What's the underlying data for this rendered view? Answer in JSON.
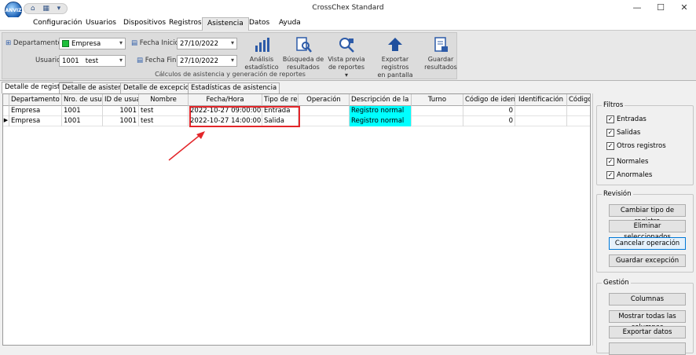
{
  "window": {
    "title": "CrossChex Standard",
    "logo_text": "ANVIZ"
  },
  "menu": [
    "Configuración",
    "Usuarios",
    "Dispositivos",
    "Registros",
    "Asistencia",
    "Datos",
    "Ayuda"
  ],
  "menu_active": "Asistencia",
  "ribbon": {
    "departamento_label": "Departamento",
    "departamento_value": "Empresa",
    "usuario_label": "Usuario",
    "usuario_id": "1001",
    "usuario_name": "test",
    "fecha_inicio_label": "Fecha Inicio",
    "fecha_inicio_value": "27/10/2022",
    "fecha_fin_label": "Fecha Fin",
    "fecha_fin_value": "27/10/2022",
    "buttons": [
      {
        "l1": "Análisis",
        "l2": "estadístico"
      },
      {
        "l1": "Búsqueda de",
        "l2": "resultados"
      },
      {
        "l1": "Vista previa",
        "l2": "de reportes ▾"
      },
      {
        "l1": "Exportar registros",
        "l2": "en pantalla"
      },
      {
        "l1": "Guardar",
        "l2": "resultados"
      }
    ],
    "group_caption": "Cálculos de asistencia y generación de reportes"
  },
  "tabs": [
    "Detalle de registros",
    "Detalle de asistencia",
    "Detalle de excepciones",
    "Estadísticas de asistencia"
  ],
  "table": {
    "headers": [
      "Departamento",
      "Nro. de usuari",
      "ID de usuari",
      "Nombre",
      "Fecha/Hora",
      "Tipo de regi",
      "Operación",
      "Descripción de la exce",
      "Turno",
      "Código de identifi",
      "Identificación",
      "Código c"
    ],
    "sort_indicator": "/",
    "rows": [
      [
        "Empresa",
        "1001",
        "1001",
        "test",
        "2022-10-27 09:00:00",
        "Entrada",
        "",
        "Registro normal",
        "",
        "0",
        "",
        ""
      ],
      [
        "Empresa",
        "1001",
        "1001",
        "test",
        "2022-10-27 14:00:00",
        "Salida",
        "",
        "Registro normal",
        "",
        "0",
        "",
        ""
      ]
    ]
  },
  "panel": {
    "filtros_title": "Filtros",
    "filtros": [
      "Entradas",
      "Salidas",
      "Otros registros",
      "Normales",
      "Anormales"
    ],
    "revision_title": "Revisión",
    "revision_buttons": [
      "Cambiar tipo de registro",
      "Eliminar seleccionados",
      "Cancelar operación",
      "Guardar excepción"
    ],
    "gestion_title": "Gestión",
    "gestion_buttons": [
      "Columnas",
      "Mostrar todas las columnas",
      "Exportar datos"
    ]
  },
  "colors": {
    "highlight_red": "#e3262a",
    "cyan": "#00ffff",
    "arrow_red": "#e3262a"
  }
}
